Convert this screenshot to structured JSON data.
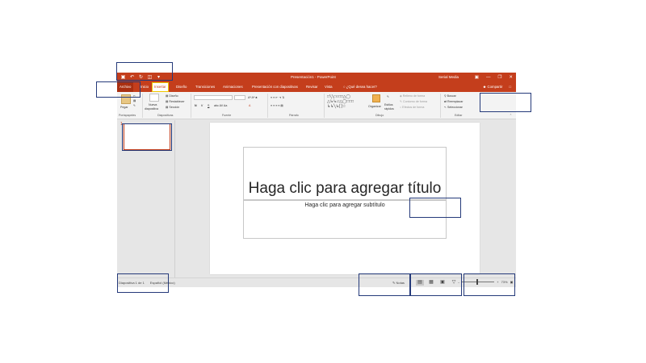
{
  "titlebar": {
    "title": "Presentación1 - PowerPoint",
    "user": "Serial Media",
    "qat_icons": [
      "save-icon",
      "undo-icon",
      "redo-icon",
      "present-icon",
      "customize-icon"
    ]
  },
  "tabs": [
    {
      "label": "Archivo"
    },
    {
      "label": "Inicio"
    },
    {
      "label": "Insertar"
    },
    {
      "label": "Diseño"
    },
    {
      "label": "Transiciones"
    },
    {
      "label": "Animaciones"
    },
    {
      "label": "Presentación con diapositivas"
    },
    {
      "label": "Revisar"
    },
    {
      "label": "Vista"
    }
  ],
  "tell_me": "¿Qué desea hacer?",
  "share": "Compartir",
  "ribbon": {
    "paste": "Pegar",
    "new_slide_1": "Nueva",
    "new_slide_2": "diapositiva",
    "layout": "Diseño",
    "reset": "Restablecer",
    "section": "Sección",
    "organize": "Organizar",
    "quick_1": "Estilos",
    "quick_2": "rápidos",
    "fill": "Relleno de forma",
    "outline": "Contorno de forma",
    "effects": "Efectos de forma",
    "find": "Buscar",
    "replace": "Reemplazar",
    "select": "Seleccionar",
    "groups": {
      "clipboard": "Portapapeles",
      "slides": "Diapositivas",
      "font": "Fuente",
      "paragraph": "Párrafo",
      "drawing": "Dibujo",
      "editing": "Editar"
    }
  },
  "thumbnail": {
    "number": "1"
  },
  "slide": {
    "title_placeholder": "Haga clic para agregar título",
    "subtitle_placeholder": "Haga clic para agregar subtítulo"
  },
  "status": {
    "slide_count": "Diapositiva 1 de 1",
    "language": "Español (México)",
    "notes": "Notas",
    "zoom": "73%"
  },
  "colors": {
    "accent": "#c43e1c",
    "highlight_box": "#253a7a"
  }
}
